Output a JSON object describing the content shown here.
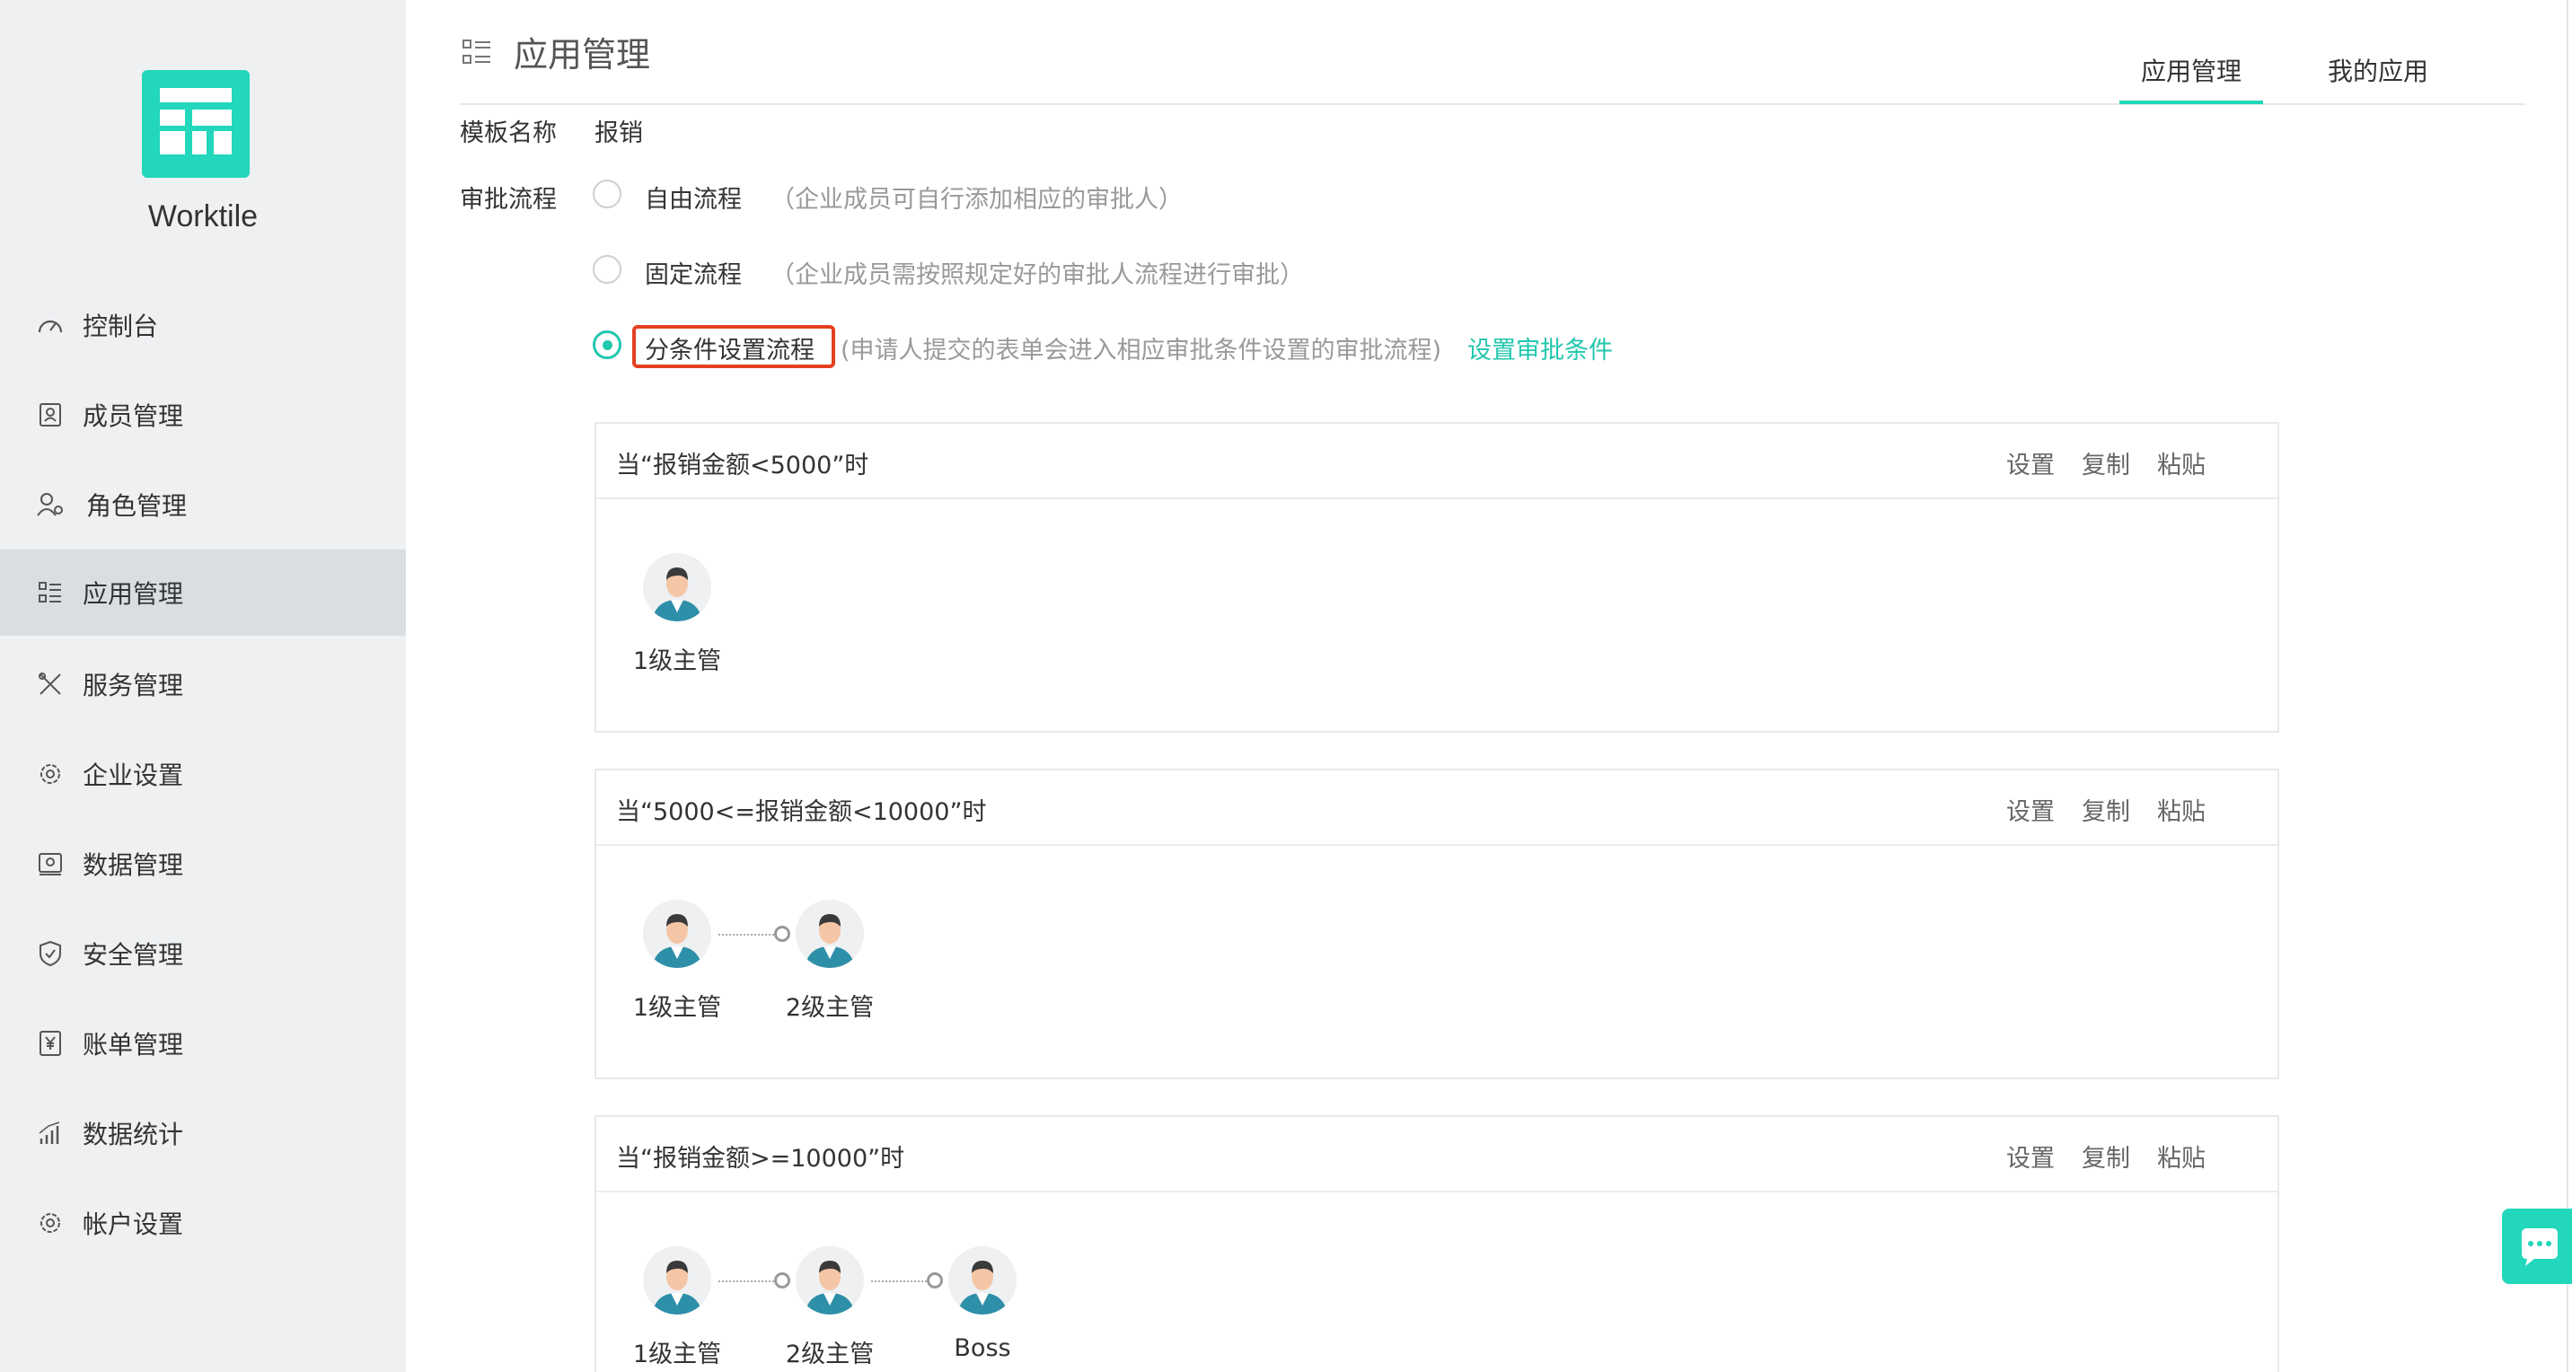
{
  "app": {
    "brand": "Worktile"
  },
  "sidebar": {
    "items": [
      {
        "label": "控制台",
        "icon": "dashboard-icon"
      },
      {
        "label": "成员管理",
        "icon": "member-card-icon"
      },
      {
        "label": "角色管理",
        "icon": "role-users-icon"
      },
      {
        "label": "应用管理",
        "icon": "app-list-icon",
        "active": true
      },
      {
        "label": "服务管理",
        "icon": "tools-icon"
      },
      {
        "label": "企业设置",
        "icon": "gear-icon"
      },
      {
        "label": "数据管理",
        "icon": "data-drive-icon"
      },
      {
        "label": "安全管理",
        "icon": "shield-icon"
      },
      {
        "label": "账单管理",
        "icon": "bill-yen-icon"
      },
      {
        "label": "数据统计",
        "icon": "bar-chart-icon"
      },
      {
        "label": "帐户设置",
        "icon": "gear-icon"
      }
    ]
  },
  "header": {
    "title": "应用管理",
    "tabs": [
      {
        "label": "应用管理",
        "active": true
      },
      {
        "label": "我的应用",
        "active": false
      }
    ]
  },
  "form": {
    "template_label": "模板名称",
    "template_value": "报销",
    "process_label": "审批流程",
    "options": [
      {
        "label": "自由流程",
        "hint": "（企业成员可自行添加相应的审批人）",
        "checked": false
      },
      {
        "label": "固定流程",
        "hint": "（企业成员需按照规定好的审批人流程进行审批）",
        "checked": false
      },
      {
        "label": "分条件设置流程",
        "hint": "(申请人提交的表单会进入相应审批条件设置的审批流程)",
        "link": "设置审批条件",
        "checked": true
      }
    ]
  },
  "conditions": [
    {
      "title": "当“报销金额<5000”时",
      "actions": [
        "设置",
        "复制",
        "粘贴"
      ],
      "approvers": [
        "1级主管"
      ]
    },
    {
      "title": "当“5000<=报销金额<10000”时",
      "actions": [
        "设置",
        "复制",
        "粘贴"
      ],
      "approvers": [
        "1级主管",
        "2级主管"
      ]
    },
    {
      "title": "当“报销金额>=10000”时",
      "actions": [
        "设置",
        "复制",
        "粘贴"
      ],
      "approvers": [
        "1级主管",
        "2级主管",
        "Boss"
      ]
    }
  ],
  "colors": {
    "accent": "#22d7bb",
    "highlight": "#e2401f",
    "sidebar_bg": "#eef0f2"
  }
}
